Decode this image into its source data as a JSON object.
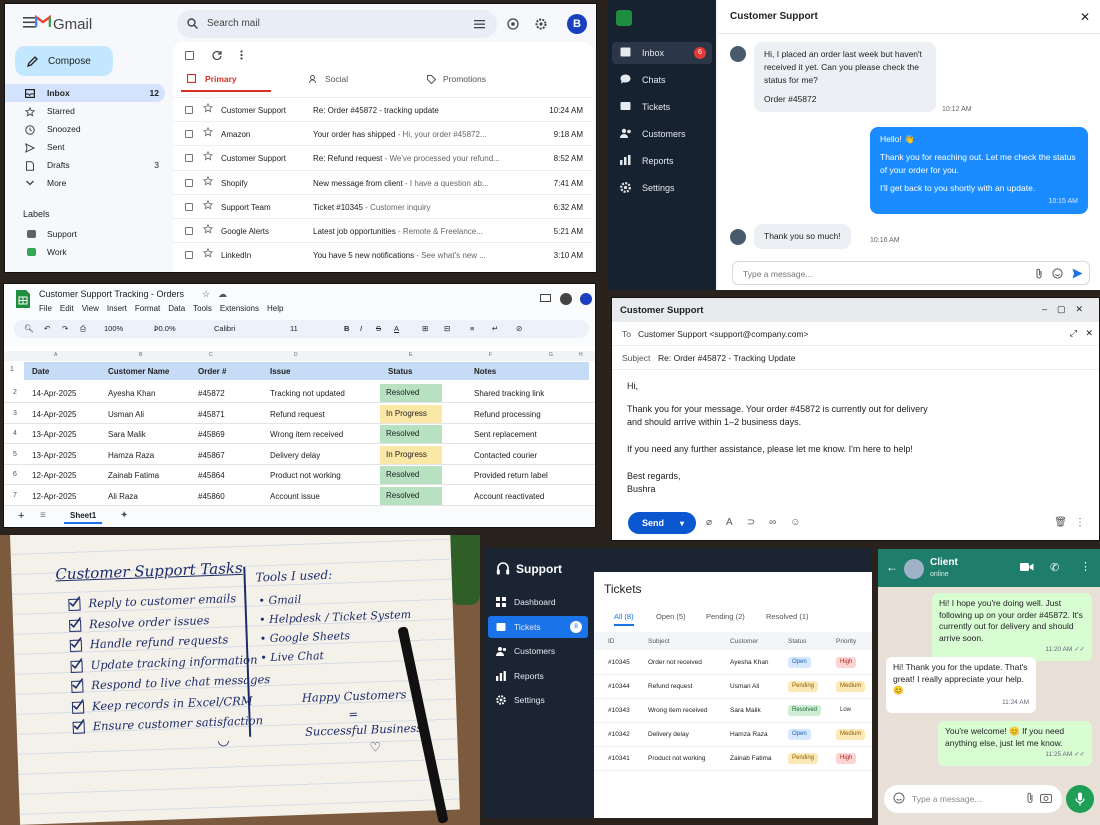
{
  "gmail": {
    "brand": "Gmail",
    "search_placeholder": "Search mail",
    "avatar_letter": "B",
    "compose": "Compose",
    "nav": [
      {
        "label": "Inbox",
        "count": "12"
      },
      {
        "label": "Starred",
        "count": ""
      },
      {
        "label": "Snoozed",
        "count": ""
      },
      {
        "label": "Sent",
        "count": ""
      },
      {
        "label": "Drafts",
        "count": "3"
      },
      {
        "label": "More",
        "count": ""
      }
    ],
    "labels_heading": "Labels",
    "labels": [
      {
        "label": "Support",
        "color": "#5f6368"
      },
      {
        "label": "Work",
        "color": "#34a853"
      }
    ],
    "tabs": [
      "Primary",
      "Social",
      "Promotions"
    ],
    "emails": [
      {
        "from": "Customer Support",
        "subject": "Re: Order #45872 - tracking update",
        "snippet": "",
        "time": "10:24 AM"
      },
      {
        "from": "Amazon",
        "subject": "Your order has shipped",
        "snippet": " - Hi, your order #45872...",
        "time": "9:18 AM"
      },
      {
        "from": "Customer Support",
        "subject": "Re: Refund request",
        "snippet": " - We've processed your refund...",
        "time": "8:52 AM"
      },
      {
        "from": "Shopify",
        "subject": "New message from client",
        "snippet": " - I have a question ab...",
        "time": "7:41 AM"
      },
      {
        "from": "Support Team",
        "subject": "Ticket #10345",
        "snippet": " - Customer inquiry",
        "time": "6:32 AM"
      },
      {
        "from": "Google Alerts",
        "subject": "Latest job opportunities",
        "snippet": " - Remote & Freelance...",
        "time": "5:21 AM"
      },
      {
        "from": "LinkedIn",
        "subject": "You have 5 new notifications",
        "snippet": " - See what's new ...",
        "time": "3:10 AM"
      }
    ]
  },
  "chat": {
    "nav": [
      {
        "label": "Inbox",
        "badge": "6"
      },
      {
        "label": "Chats",
        "badge": ""
      },
      {
        "label": "Tickets",
        "badge": ""
      },
      {
        "label": "Customers",
        "badge": ""
      },
      {
        "label": "Reports",
        "badge": ""
      },
      {
        "label": "Settings",
        "badge": ""
      }
    ],
    "title": "Customer Support",
    "msg1": "Hi, I placed an order last week but haven't received it yet. Can you please check the status for me?",
    "msg1_order": "Order #45872",
    "msg1_time": "10:12 AM",
    "msg2_greet": "Hello! 👋",
    "msg2_body": "Thank you for reaching out. Let me check the status of your order for you.",
    "msg2_tail": "I'll get back to you shortly with an update.",
    "msg2_time": "10:15 AM",
    "msg3": "Thank you so much!",
    "msg3_time": "10:16 AM",
    "input_placeholder": "Type a message..."
  },
  "sheets": {
    "title": "Customer Support Tracking - Orders",
    "menu": [
      "File",
      "Edit",
      "View",
      "Insert",
      "Format",
      "Data",
      "Tools",
      "Extensions",
      "Help"
    ],
    "zoom": "100%",
    "format": "Ꝧ0.0%",
    "font": "Calibri",
    "size": "11",
    "col_letters": [
      "A",
      "B",
      "C",
      "D",
      "E",
      "F",
      "G",
      "H"
    ],
    "headers": [
      "Date",
      "Customer Name",
      "Order #",
      "Issue",
      "Status",
      "Notes"
    ],
    "rows": [
      {
        "n": "2",
        "date": "14-Apr-2025",
        "name": "Ayesha Khan",
        "order": "#45872",
        "issue": "Tracking not updated",
        "status": "Resolved",
        "notes": "Shared tracking link"
      },
      {
        "n": "3",
        "date": "14-Apr-2025",
        "name": "Usman Ali",
        "order": "#45871",
        "issue": "Refund request",
        "status": "In Progress",
        "notes": "Refund processing"
      },
      {
        "n": "4",
        "date": "13-Apr-2025",
        "name": "Sara Malik",
        "order": "#45869",
        "issue": "Wrong item received",
        "status": "Resolved",
        "notes": "Sent replacement"
      },
      {
        "n": "5",
        "date": "13-Apr-2025",
        "name": "Hamza Raza",
        "order": "#45867",
        "issue": "Delivery delay",
        "status": "In Progress",
        "notes": "Contacted courier"
      },
      {
        "n": "6",
        "date": "12-Apr-2025",
        "name": "Zainab Fatima",
        "order": "#45864",
        "issue": "Product not working",
        "status": "Resolved",
        "notes": "Provided return label"
      },
      {
        "n": "7",
        "date": "12-Apr-2025",
        "name": "Ali Raza",
        "order": "#45860",
        "issue": "Account issue",
        "status": "Resolved",
        "notes": "Account reactivated"
      }
    ],
    "sheet_tab": "Sheet1",
    "colors": {
      "resolved": "#b7e1c1",
      "in_progress": "#fce8a6",
      "header": "#c6dbf5"
    }
  },
  "email": {
    "title": "Customer Support",
    "to_label": "To",
    "to_value": "Customer Support  <support@company.com>",
    "subject_label": "Subject",
    "subject_value": "Re: Order #45872 - Tracking Update",
    "greeting": "Hi,",
    "para1a": "Thank you for your message. Your order #45872 is currently out for delivery",
    "para1b": "and should arrive within 1–2 business days.",
    "para2": "If you need any further assistance, please let me know. I'm here to help!",
    "signoff": "Best regards,",
    "signer": "Bushra",
    "send": "Send"
  },
  "notebook": {
    "title": "Customer Support Tasks",
    "tasks": [
      "Reply to customer emails",
      "Resolve order issues",
      "Handle refund requests",
      "Update tracking information",
      "Respond to live chat messages",
      "Keep records in Excel/CRM",
      "Ensure customer satisfaction"
    ],
    "tools_heading": "Tools I used:",
    "tools": [
      "Gmail",
      "Helpdesk / Ticket System",
      "Google Sheets",
      "Live Chat"
    ],
    "motto1": "Happy Customers",
    "motto_eq": "=",
    "motto2": "Successful Business",
    "smile": "◡",
    "heart": "♡"
  },
  "support": {
    "brand": "Support",
    "nav": [
      {
        "label": "Dashboard",
        "badge": ""
      },
      {
        "label": "Tickets",
        "badge": "8"
      },
      {
        "label": "Customers",
        "badge": ""
      },
      {
        "label": "Reports",
        "badge": ""
      },
      {
        "label": "Settings",
        "badge": ""
      }
    ],
    "title": "Tickets",
    "filters": [
      "All (8)",
      "Open (5)",
      "Pending (2)",
      "Resolved (1)"
    ],
    "headers": [
      "ID",
      "Subject",
      "Customer",
      "Status",
      "Priority"
    ],
    "tickets": [
      {
        "id": "#10345",
        "subject": "Order not received",
        "customer": "Ayesha Khan",
        "status": "Open",
        "priority": "High"
      },
      {
        "id": "#10344",
        "subject": "Refund request",
        "customer": "Usman Ali",
        "status": "Pending",
        "priority": "Medium"
      },
      {
        "id": "#10343",
        "subject": "Wrong item received",
        "customer": "Sara Malik",
        "status": "Resolved",
        "priority": "Low"
      },
      {
        "id": "#10342",
        "subject": "Delivery delay",
        "customer": "Hamza Raza",
        "status": "Open",
        "priority": "Medium"
      },
      {
        "id": "#10341",
        "subject": "Product not working",
        "customer": "Zainab Fatima",
        "status": "Pending",
        "priority": "High"
      }
    ]
  },
  "whatsapp": {
    "name": "Client",
    "status": "online",
    "m1": "Hi! I hope you're doing well. Just following up on your order #45872. It's currently out for delivery and should arrive soon.",
    "m1_time": "11:20 AM ✓✓",
    "m2": "Hi! Thank you for the update. That's great! I really appreciate your help. 😊",
    "m2_time": "11:24 AM",
    "m3": "You're welcome! 😊 If you need anything else, just let me know.",
    "m3_time": "11:25 AM ✓✓",
    "input_placeholder": "Type a message..."
  }
}
